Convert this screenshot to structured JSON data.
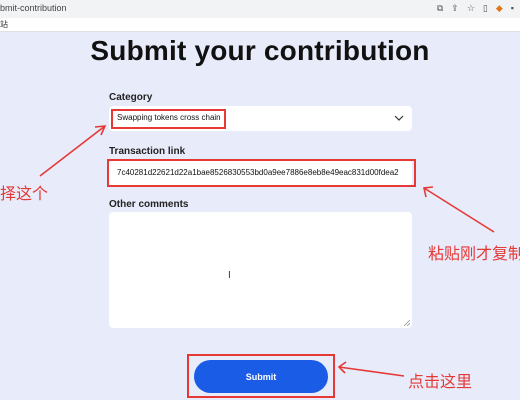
{
  "browser": {
    "url": "bmit-contribution",
    "bookmark": "站"
  },
  "page": {
    "title": "Submit your contribution",
    "category_label": "Category",
    "category_value": "Swapping tokens cross chain",
    "tx_label": "Transaction link",
    "tx_value": "7c40281d22621d22a1bae8526830553bd0a9ee7886e8eb8e49eac831d00fdea2",
    "comments_label": "Other comments",
    "submit_label": "Submit"
  },
  "annotations": {
    "left": "择这个",
    "right": "粘贴刚才复制",
    "bottom": "点击这里",
    "color": "#e53935"
  },
  "icons": {
    "chevron": "chevron-down-icon",
    "text_cursor": "text-cursor-icon"
  }
}
